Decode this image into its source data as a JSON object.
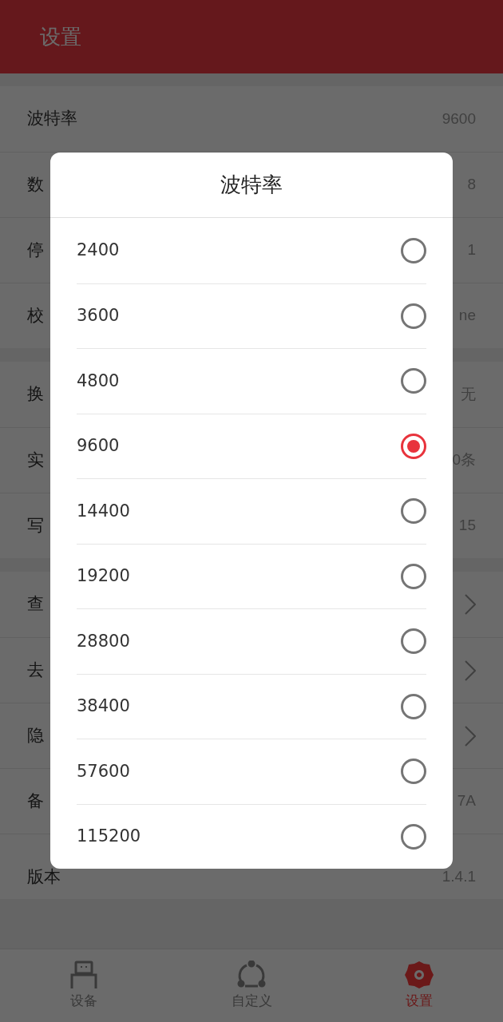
{
  "header": {
    "title": "设置"
  },
  "sections": [
    {
      "rows": [
        {
          "label": "波特率",
          "value": "9600",
          "kind": "value"
        },
        {
          "label": "数",
          "value": "8",
          "kind": "value"
        },
        {
          "label": "停",
          "value": "1",
          "kind": "value"
        },
        {
          "label": "校",
          "value": "ne",
          "kind": "value"
        }
      ]
    },
    {
      "rows": [
        {
          "label": "换",
          "value": "无",
          "kind": "value"
        },
        {
          "label": "实",
          "value": "0条",
          "kind": "value"
        },
        {
          "label": "写",
          "value": "15",
          "kind": "value"
        }
      ]
    },
    {
      "rows": [
        {
          "label": "查",
          "kind": "link"
        },
        {
          "label": "去",
          "kind": "link"
        },
        {
          "label": "隐",
          "kind": "link"
        },
        {
          "label": "备",
          "value": "7A",
          "kind": "value"
        },
        {
          "label": "版本",
          "value": "1.4.1",
          "kind": "value"
        }
      ]
    }
  ],
  "dialog": {
    "title": "波特率",
    "options": [
      {
        "label": "2400",
        "selected": false
      },
      {
        "label": "3600",
        "selected": false
      },
      {
        "label": "4800",
        "selected": false
      },
      {
        "label": "9600",
        "selected": true
      },
      {
        "label": "14400",
        "selected": false
      },
      {
        "label": "19200",
        "selected": false
      },
      {
        "label": "28800",
        "selected": false
      },
      {
        "label": "38400",
        "selected": false
      },
      {
        "label": "57600",
        "selected": false
      },
      {
        "label": "115200",
        "selected": false
      }
    ]
  },
  "nav": [
    {
      "label": "设备",
      "selected": false
    },
    {
      "label": "自定义",
      "selected": false
    },
    {
      "label": "设置",
      "selected": true
    }
  ]
}
